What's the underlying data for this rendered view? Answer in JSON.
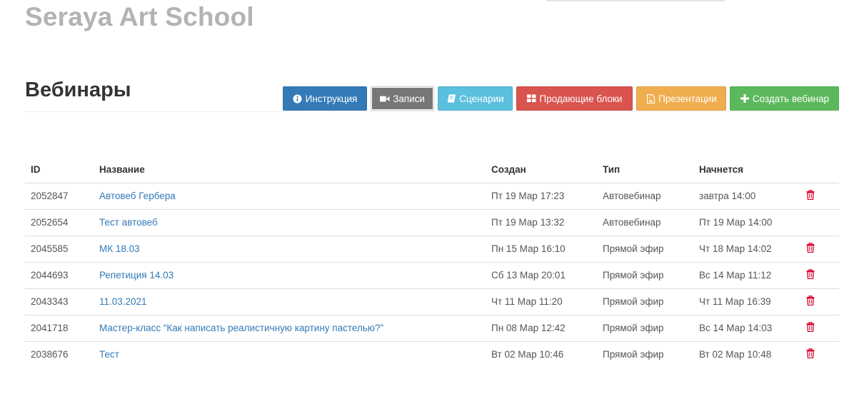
{
  "brand": {
    "name": "Seraya Art School"
  },
  "page": {
    "title": "Вебинары"
  },
  "toolbar": {
    "instruction": "Инструкция",
    "recordings": "Записи",
    "scenarios": "Сценарии",
    "sales_blocks": "Продающие блоки",
    "presentations": "Презентации",
    "create": "Создать вебинар"
  },
  "table": {
    "headers": {
      "id": "ID",
      "name": "Название",
      "created": "Создан",
      "type": "Тип",
      "starts": "Начнется"
    },
    "rows": [
      {
        "id": "2052847",
        "name": "Автовеб Гербера",
        "created": "Пт 19 Мар 17:23",
        "type": "Автовебинар",
        "starts": "завтра 14:00",
        "deletable": true
      },
      {
        "id": "2052654",
        "name": "Тест автовеб",
        "created": "Пт 19 Мар 13:32",
        "type": "Автовебинар",
        "starts": "Пт 19 Мар 14:00",
        "deletable": false
      },
      {
        "id": "2045585",
        "name": "МК 18.03",
        "created": "Пн 15 Мар 16:10",
        "type": "Прямой эфир",
        "starts": "Чт 18 Мар 14:02",
        "deletable": true
      },
      {
        "id": "2044693",
        "name": "Репетиция 14.03",
        "created": "Сб 13 Мар 20:01",
        "type": "Прямой эфир",
        "starts": "Вс 14 Мар 11:12",
        "deletable": true
      },
      {
        "id": "2043343",
        "name": "11.03.2021",
        "created": "Чт 11 Мар 11:20",
        "type": "Прямой эфир",
        "starts": "Чт 11 Мар 16:39",
        "deletable": true
      },
      {
        "id": "2041718",
        "name": "Мастер-класс “Как написать реалистичную картину пастелью?”",
        "created": "Пн 08 Мар 12:42",
        "type": "Прямой эфир",
        "starts": "Вс 14 Мар 14:03",
        "deletable": true
      },
      {
        "id": "2038676",
        "name": "Тест",
        "created": "Вт 02 Мар 10:46",
        "type": "Прямой эфир",
        "starts": "Вт 02 Мар 10:48",
        "deletable": true
      }
    ]
  },
  "colors": {
    "brand_text": "#b3b3b3",
    "primary": "#337ab7",
    "default_btn": "#777777",
    "info": "#5bc0de",
    "danger": "#d9534f",
    "warning": "#f0ad4e",
    "success": "#5cb85c",
    "link": "#337ab7",
    "trash": "#d9002c"
  },
  "icons": {
    "instruction": "info-circle-icon",
    "recordings": "video-camera-icon",
    "scenarios": "book-icon",
    "sales_blocks": "grid-icon",
    "presentations": "file-image-icon",
    "create": "plus-icon",
    "delete": "trash-icon"
  }
}
